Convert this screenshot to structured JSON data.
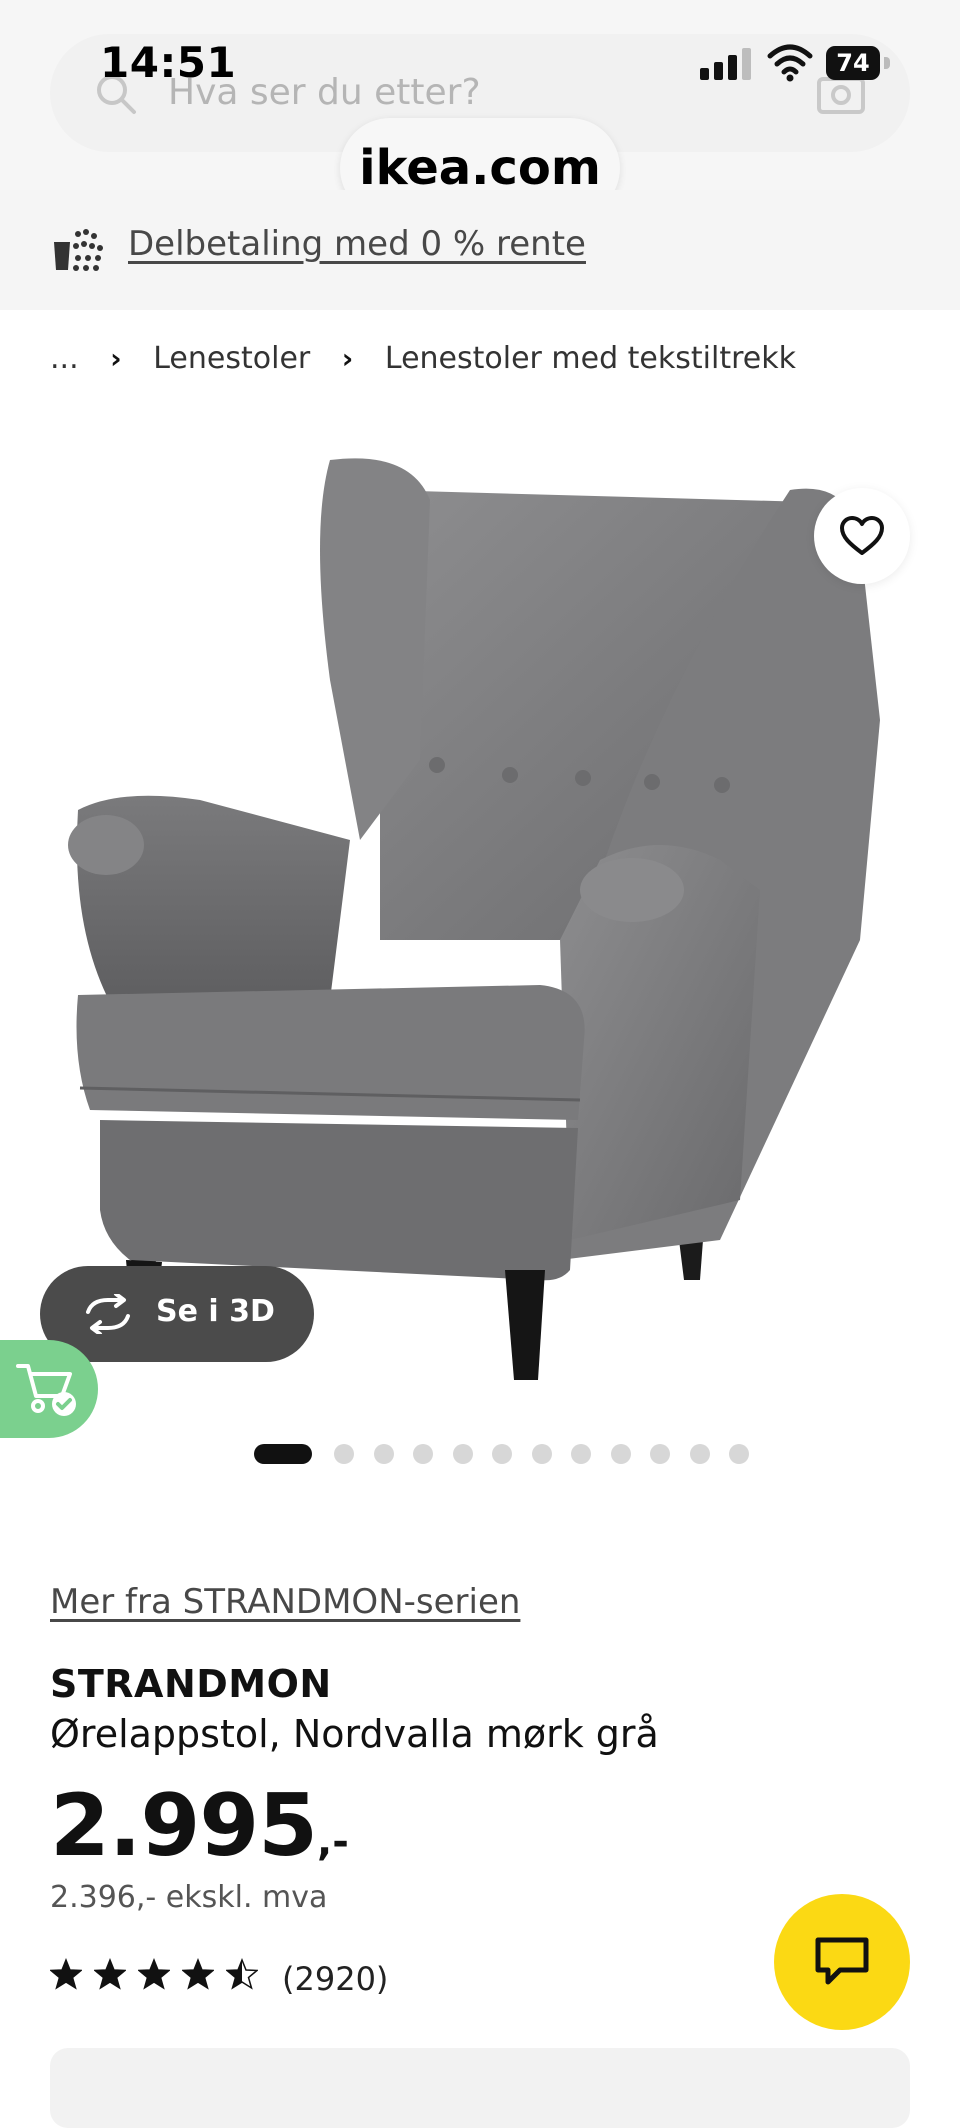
{
  "status_bar": {
    "time": "14:51",
    "battery": "74"
  },
  "search": {
    "placeholder": "Hva ser du etter?"
  },
  "browser": {
    "url": "ikea.com"
  },
  "promo": {
    "label": "Delbetaling med 0 % rente"
  },
  "breadcrumb": {
    "ellipsis": "...",
    "separator": "›",
    "items": [
      "Lenestoler",
      "Lenestoler med tekstiltrekk"
    ]
  },
  "product": {
    "view3d_label": "Se i 3D",
    "carousel": {
      "total": 12,
      "active_index": 1
    },
    "series_link": "Mer fra STRANDMON-serien",
    "name": "STRANDMON",
    "description": "Ørelappstol, Nordvalla mørk grå",
    "price_main": "2.995",
    "price_suffix": ",-",
    "price_ex_vat": "2.396,- ekskl. mva",
    "rating": {
      "stars": 4.5,
      "max": 5,
      "count": "(2920)"
    }
  },
  "colors": {
    "chat_button": "#fbd914",
    "cart_fab": "#7bd08e",
    "view3d_button": "#4b4b4b"
  },
  "icons": {
    "search": "search-icon",
    "camera": "camera-icon",
    "favorite": "heart-icon",
    "rotate": "rotate-3d-icon",
    "cart": "cart-check-icon",
    "chat": "chat-icon",
    "installment": "installment-icon"
  }
}
